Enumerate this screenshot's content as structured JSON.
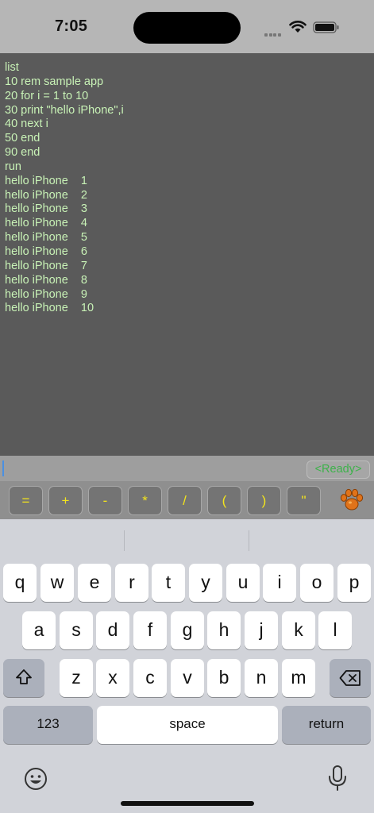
{
  "status": {
    "time": "7:05"
  },
  "console": {
    "lines": [
      "list",
      "10 rem sample app",
      "20 for i = 1 to 10",
      "30 print \"hello iPhone\",i",
      "40 next i",
      "50 end",
      "90 end",
      "run",
      "hello iPhone    1",
      "hello iPhone    2",
      "hello iPhone    3",
      "hello iPhone    4",
      "hello iPhone    5",
      "hello iPhone    6",
      "hello iPhone    7",
      "hello iPhone    8",
      "hello iPhone    9",
      "hello iPhone    10"
    ]
  },
  "input": {
    "status": "<Ready>"
  },
  "symbols": [
    "=",
    "+",
    "-",
    "*",
    "/",
    "(",
    ")",
    "\""
  ],
  "keyboard": {
    "row1": [
      "q",
      "w",
      "e",
      "r",
      "t",
      "y",
      "u",
      "i",
      "o",
      "p"
    ],
    "row2": [
      "a",
      "s",
      "d",
      "f",
      "g",
      "h",
      "j",
      "k",
      "l"
    ],
    "row3": [
      "z",
      "x",
      "c",
      "v",
      "b",
      "n",
      "m"
    ],
    "numbers_label": "123",
    "space_label": "space",
    "return_label": "return"
  },
  "colors": {
    "console_bg": "#5a5a5a",
    "console_text": "#c8f2b6",
    "ready_text": "#3db24a",
    "symbol_text": "#f3e41c"
  }
}
